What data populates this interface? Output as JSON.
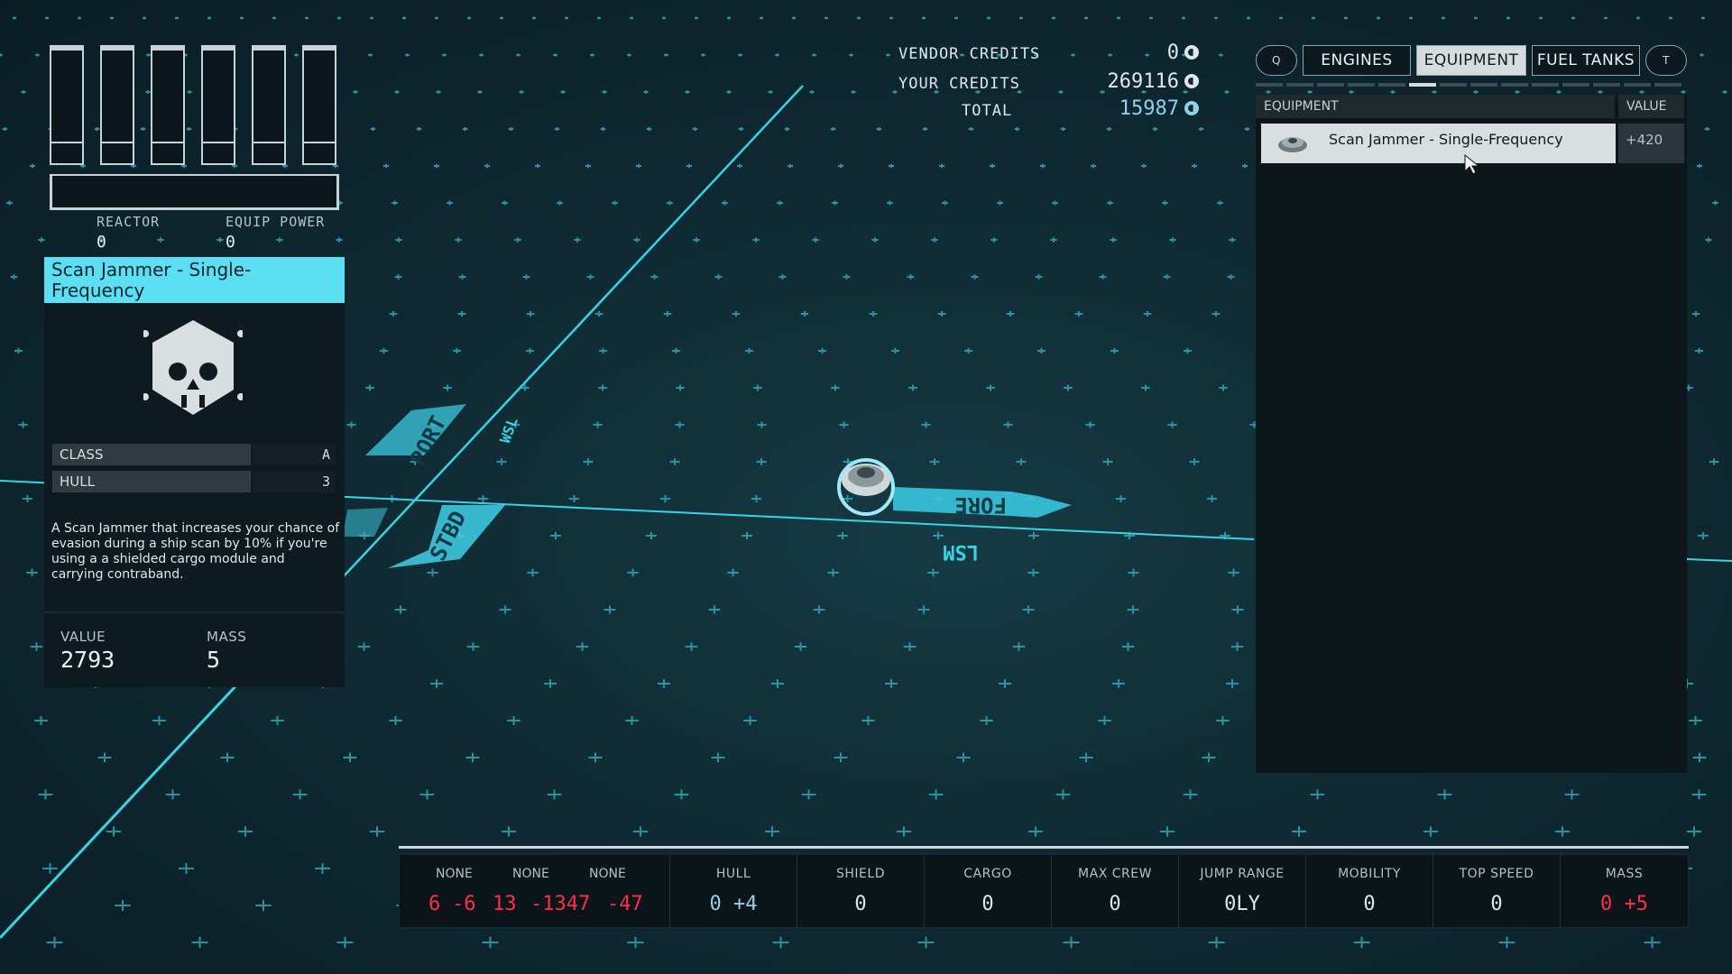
{
  "power": {
    "reactor_label": "REACTOR",
    "reactor_value": "0",
    "equip_label": "EQUIP POWER",
    "equip_value": "0"
  },
  "item": {
    "title": "Scan Jammer - Single-Frequency",
    "icon": "skull-icon",
    "stats": [
      {
        "label": "CLASS",
        "value": "A"
      },
      {
        "label": "HULL",
        "value": "3"
      }
    ],
    "description": "A Scan Jammer that increases your chance of evasion during a ship scan by 10% if you're using a a shielded cargo module and carrying contraband.",
    "value_label": "VALUE",
    "value": "2793",
    "mass_label": "MASS",
    "mass": "5"
  },
  "credits": {
    "vendor_label": "VENDOR CREDITS",
    "vendor_value": "0",
    "yours_label": "YOUR CREDITS",
    "yours_value": "269116",
    "total_label": "TOTAL",
    "total_value": "15987",
    "icon": "credits-icon"
  },
  "tabs": {
    "prev_key": "Q",
    "next_key": "T",
    "items": [
      "ENGINES",
      "EQUIPMENT",
      "FUEL TANKS"
    ],
    "active": "EQUIPMENT"
  },
  "list": {
    "col_equipment": "EQUIPMENT",
    "col_value": "VALUE",
    "rows": [
      {
        "name": "Scan Jammer - Single-Frequency",
        "value": "+420"
      }
    ]
  },
  "ship_labels": {
    "fore": "FORE",
    "port": "PORT",
    "stbd": "STBD",
    "lsm": "LSM",
    "fore_up": "WSL"
  },
  "bottom": {
    "none_labels": [
      "NONE",
      "NONE",
      "NONE"
    ],
    "none_values": [
      "6",
      "-6",
      "13",
      "-1347",
      "-47"
    ],
    "hull_label": "HULL",
    "hull_value": "0",
    "hull_delta": "+4",
    "shield_label": "SHIELD",
    "shield_value": "0",
    "cargo_label": "CARGO",
    "cargo_value": "0",
    "crew_label": "MAX CREW",
    "crew_value": "0",
    "jump_label": "JUMP RANGE",
    "jump_value": "0LY",
    "mobility_label": "MOBILITY",
    "mobility_value": "0",
    "speed_label": "TOP SPEED",
    "speed_value": "0",
    "mass_label": "MASS",
    "mass_value": "0",
    "mass_delta": "+5"
  },
  "colors": {
    "accent": "#5bdff2",
    "negative": "#ff2d47",
    "positive": "#8fd2ee"
  }
}
